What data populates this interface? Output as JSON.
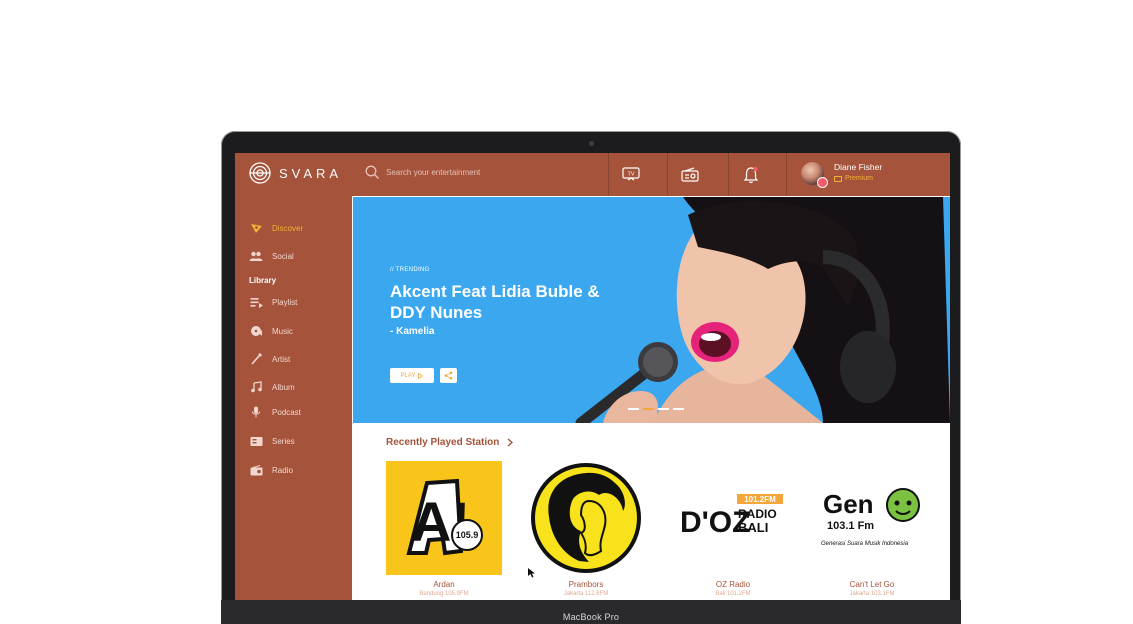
{
  "device": {
    "label": "MacBook Pro"
  },
  "app": {
    "brand": "SVARA",
    "accent": "#a5533a",
    "highlight": "#f4b23a",
    "hero_bg": "#3aa7ef"
  },
  "search": {
    "placeholder": "Search your entertainment"
  },
  "top_icons": [
    "tv-icon",
    "radio-icon",
    "bell-icon"
  ],
  "user": {
    "name": "Diane Fisher",
    "tier": "Premium"
  },
  "sidebar": {
    "items": [
      {
        "label": "Discover",
        "icon": "discover-icon",
        "active": true
      },
      {
        "label": "Social",
        "icon": "social-icon"
      }
    ],
    "library_heading": "Library",
    "library_items": [
      {
        "label": "Playlist",
        "icon": "playlist-icon"
      },
      {
        "label": "Music",
        "icon": "music-icon"
      },
      {
        "label": "Artist",
        "icon": "artist-icon"
      },
      {
        "label": "Album",
        "icon": "album-icon"
      },
      {
        "label": "Podcast",
        "icon": "podcast-icon"
      },
      {
        "label": "Series",
        "icon": "series-icon"
      },
      {
        "label": "Radio",
        "icon": "radio-icon"
      }
    ]
  },
  "hero": {
    "tag": "// TRENDING",
    "title": "Akcent Feat Lidia Buble & DDY Nunes",
    "subtitle": "- Kamelia",
    "play_label": "PLAY",
    "slides_total": 4,
    "slide_active": 2
  },
  "recent": {
    "title": "Recently Played Station",
    "stations": [
      {
        "name": "Ardan",
        "freq": "Bandung 105.9FM",
        "logo_text": "A!",
        "logo_sub": "105.9"
      },
      {
        "name": "Prambors",
        "freq": "Jakarta 112.6FM"
      },
      {
        "name": "OZ Radio",
        "freq": "Bali 101.2FM",
        "logo_text": "D'OZ",
        "logo_sub": "101.2FM RADIO BALI"
      },
      {
        "name": "Can't Let Go",
        "freq": "Jakarta 103.1FM",
        "logo_text": "Gen",
        "logo_sub": "103.1 Fm",
        "logo_caption": "Generasi Suara Musik Indonesia"
      }
    ]
  }
}
